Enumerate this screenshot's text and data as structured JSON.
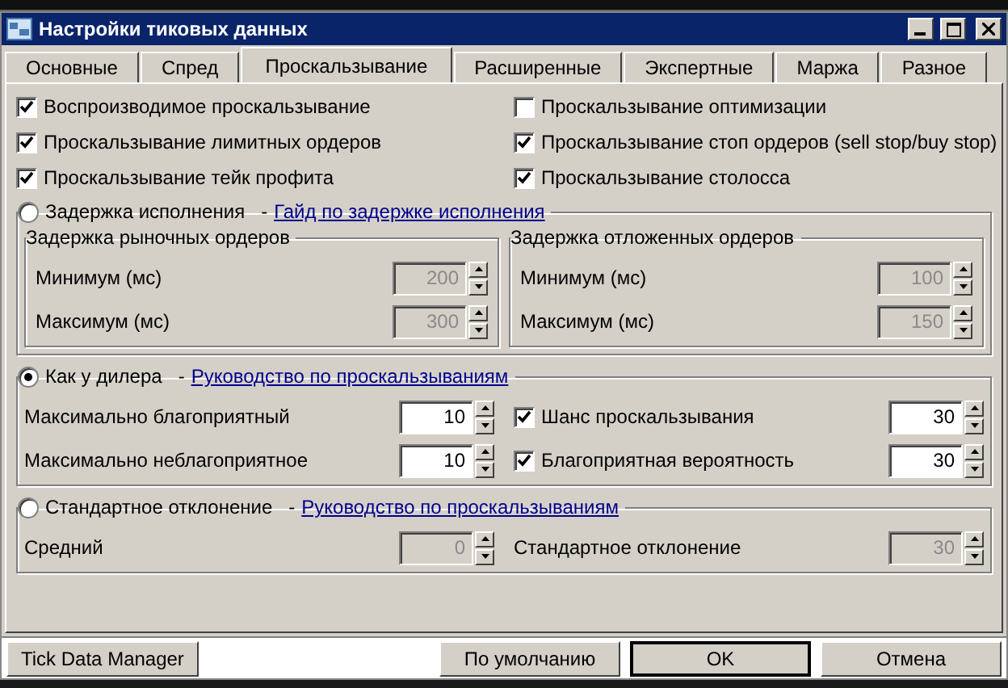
{
  "window": {
    "title": "Настройки тиковых данных"
  },
  "tabs": [
    {
      "label": "Основные",
      "selected": false
    },
    {
      "label": "Спред",
      "selected": false
    },
    {
      "label": "Проскальзывание",
      "selected": true
    },
    {
      "label": "Расширенные",
      "selected": false
    },
    {
      "label": "Экспертные",
      "selected": false
    },
    {
      "label": "Маржа",
      "selected": false
    },
    {
      "label": "Разное",
      "selected": false
    }
  ],
  "options": [
    {
      "label": "Воспроизводимое проскальзывание",
      "checked": true
    },
    {
      "label": "Проскальзывание оптимизации",
      "checked": false
    },
    {
      "label": "Проскальзывание лимитных ордеров",
      "checked": true
    },
    {
      "label": "Проскальзывание стоп ордеров (sell stop/buy stop)",
      "checked": true
    },
    {
      "label": "Проскальзывание тейк профита",
      "checked": true
    },
    {
      "label": "Проскальзывание столосса",
      "checked": true
    }
  ],
  "modes": [
    {
      "label": "Задержка исполнения",
      "selected": false,
      "separator": "-",
      "link": "Гайд по задержке исполнения",
      "subgroups": [
        {
          "title": "Задержка рыночных ордеров",
          "fields": [
            {
              "kind": "plain",
              "label": "Минимум (мс)",
              "value": "200",
              "disabled": true
            },
            {
              "kind": "plain",
              "label": "Максимум (мс)",
              "value": "300",
              "disabled": true
            }
          ]
        },
        {
          "title": "Задержка отложенных ордеров",
          "fields": [
            {
              "kind": "plain",
              "label": "Минимум (мс)",
              "value": "100",
              "disabled": true
            },
            {
              "kind": "plain",
              "label": "Максимум (мс)",
              "value": "150",
              "disabled": true
            }
          ]
        }
      ]
    },
    {
      "label": "Как у дилера",
      "selected": true,
      "separator": "-",
      "link": "Руководство по проскальзываниям",
      "columns": [
        {
          "fields": [
            {
              "kind": "plain",
              "label": "Максимально благоприятный",
              "value": "10",
              "disabled": false
            },
            {
              "kind": "plain",
              "label": "Максимально неблагоприятное",
              "value": "10",
              "disabled": false
            }
          ]
        },
        {
          "fields": [
            {
              "kind": "check",
              "label": "Шанс проскальзывания",
              "checked": true,
              "value": "30",
              "disabled": false
            },
            {
              "kind": "check",
              "label": "Благоприятная вероятность",
              "checked": true,
              "value": "30",
              "disabled": false
            }
          ]
        }
      ]
    },
    {
      "label": "Стандартное отклонение",
      "selected": false,
      "separator": "-",
      "link": "Руководство по проскальзываниям",
      "columns": [
        {
          "fields": [
            {
              "kind": "plain",
              "label": "Средний",
              "value": "0",
              "disabled": true
            }
          ]
        },
        {
          "fields": [
            {
              "kind": "plain",
              "label": "Стандартное отклонение",
              "value": "30",
              "disabled": true
            }
          ]
        }
      ]
    }
  ],
  "buttons": [
    {
      "label": "Tick Data Manager",
      "default": false
    },
    {
      "label": "По умолчанию",
      "default": false
    },
    {
      "label": "OK",
      "default": true
    },
    {
      "label": "Отмена",
      "default": false
    }
  ]
}
